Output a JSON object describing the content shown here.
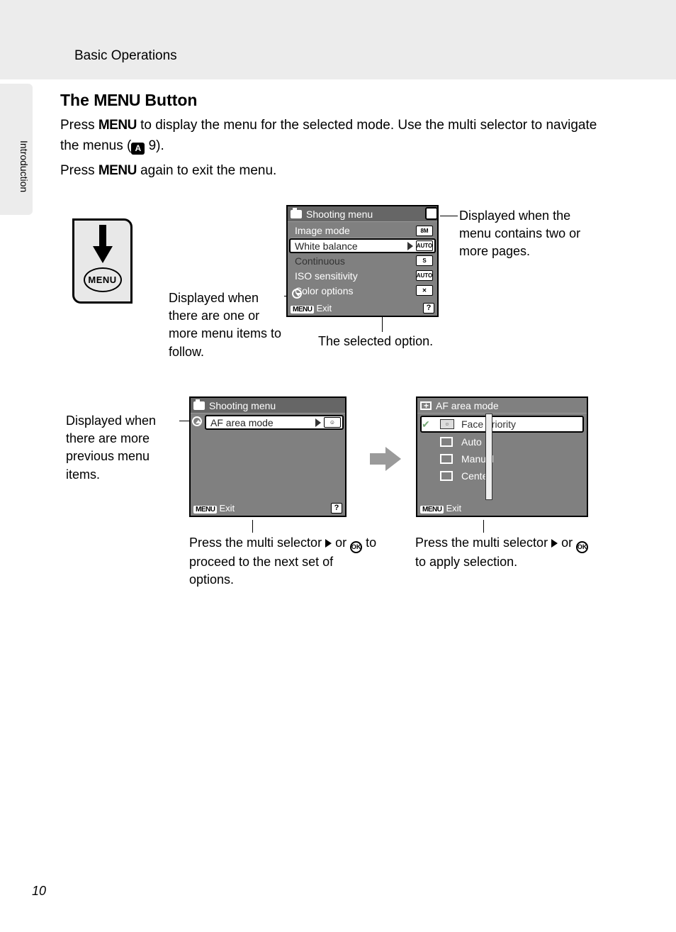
{
  "header": {
    "section": "Basic Operations"
  },
  "sideTab": "Introduction",
  "title": {
    "prefix": "The ",
    "menuWord": "MENU",
    "suffix": " Button"
  },
  "para1": {
    "p1a": "Press ",
    "menu1": "MENU",
    "p1b": " to display the menu for the selected mode. Use the multi selector to navigate the menus (",
    "refIcon": "A",
    "refNum": " 9)."
  },
  "para2": {
    "a": "Press ",
    "menu": "MENU",
    "b": " again to exit the menu."
  },
  "menuButton": {
    "label": "MENU"
  },
  "callouts": {
    "pages": "Displayed when the menu contains two or more pages.",
    "follow": "Displayed when there are one or more menu items to follow.",
    "selected": "The selected option.",
    "previous": "Displayed when there are more previous menu items.",
    "proceed_a": "Press the multi selector ",
    "proceed_b": " or ",
    "proceed_ok": "OK",
    "proceed_c": " to proceed to the next set of options.",
    "apply_a": "Press the multi selector ",
    "apply_b": " or ",
    "apply_ok": "OK",
    "apply_c": " to apply selection."
  },
  "screen1": {
    "title": "Shooting menu",
    "items": [
      {
        "label": "Image mode",
        "badge": "8M"
      },
      {
        "label": "White balance",
        "badge": "AUTO",
        "selected": true
      },
      {
        "label": "Continuous",
        "badge": "S"
      },
      {
        "label": "ISO sensitivity",
        "badge": "AUTO"
      },
      {
        "label": "Color options",
        "badge": "✕"
      }
    ],
    "exitBadge": "MENU",
    "exit": "Exit",
    "help": "?"
  },
  "screen2": {
    "title": "Shooting menu",
    "item": {
      "label": "AF area mode",
      "badge": "☺"
    },
    "exitBadge": "MENU",
    "exit": "Exit",
    "help": "?"
  },
  "screen3": {
    "title": "AF area mode",
    "items": [
      {
        "label": "Face priority",
        "selected": true,
        "checked": true
      },
      {
        "label": "Auto"
      },
      {
        "label": "Manual"
      },
      {
        "label": "Center"
      }
    ],
    "exitBadge": "MENU",
    "exit": "Exit"
  },
  "pageNumber": "10"
}
